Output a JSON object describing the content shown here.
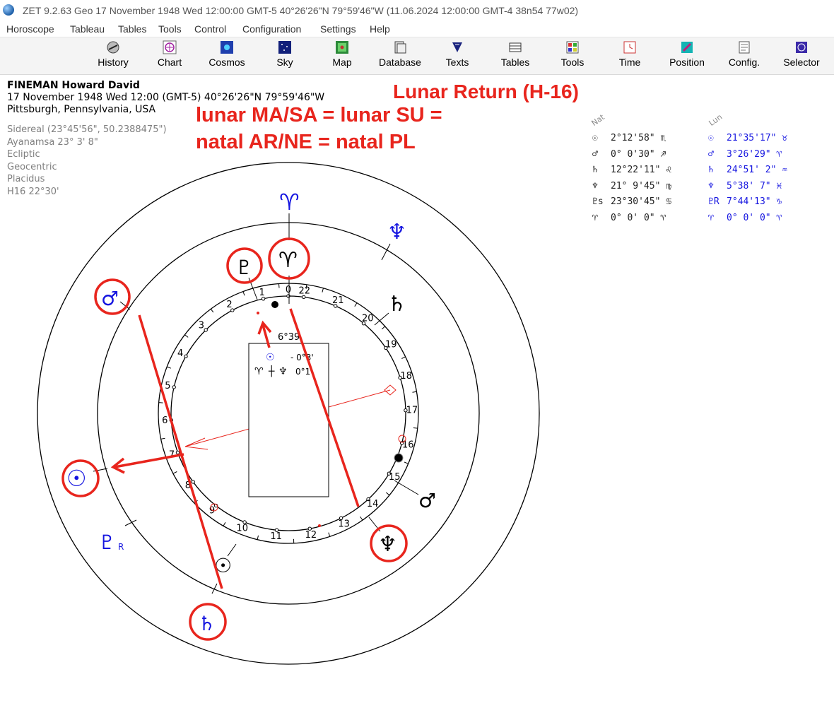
{
  "window": {
    "title": "ZET 9.2.63 Geo   17 November 1948  Wed  12:00:00 GMT-5 40°26'26\"N  79°59'46\"W  (11.06.2024  12:00:00 GMT-4 38n54 77w02)"
  },
  "menu": [
    "Horoscope",
    "Tableau",
    "Tables",
    "Tools",
    "Control",
    "Configuration",
    "Settings",
    "Help"
  ],
  "toolbar": [
    {
      "label": "History",
      "icon": "history-icon"
    },
    {
      "label": "Chart",
      "icon": "chart-icon"
    },
    {
      "label": "Cosmos",
      "icon": "cosmos-icon"
    },
    {
      "label": "Sky",
      "icon": "sky-icon"
    },
    {
      "label": "Map",
      "icon": "map-icon"
    },
    {
      "label": "Database",
      "icon": "database-icon"
    },
    {
      "label": "Texts",
      "icon": "texts-icon"
    },
    {
      "label": "Tables",
      "icon": "tables-icon"
    },
    {
      "label": "Tools",
      "icon": "tools-icon"
    },
    {
      "label": "Time",
      "icon": "time-icon"
    },
    {
      "label": "Position",
      "icon": "position-icon"
    },
    {
      "label": "Config.",
      "icon": "config-icon"
    },
    {
      "label": "Selector",
      "icon": "selector-icon"
    }
  ],
  "person": {
    "name": "FINEMAN Howard David",
    "date_line": "17 November 1948  Wed  12:00 (GMT-5) 40°26'26\"N  79°59'46\"W",
    "place": "Pittsburgh, Pennsylvania, USA"
  },
  "settings": [
    "Sidereal (23°45'56\", 50.2388475\")",
    "Ayanamsa 23° 3' 8\"",
    "Ecliptic",
    "Geocentric",
    "Placidus",
    "H16  22°30'"
  ],
  "annotations": {
    "title": "Lunar Return (H-16)",
    "line1": "lunar MA/SA = lunar SU =",
    "line2": "natal AR/NE = natal PL"
  },
  "positions": {
    "nat_header": "Nat",
    "lun_header": "Lun",
    "rows": [
      {
        "nat_sym": "☉",
        "nat": "2°12'58\" ♏",
        "lun_sym": "☉",
        "lun": "21°35'17\" ♉"
      },
      {
        "nat_sym": "♂",
        "nat": "0° 0'30\" ♐",
        "lun_sym": "♂",
        "lun": "3°26'29\" ♈"
      },
      {
        "nat_sym": "♄",
        "nat": "12°22'11\" ♌",
        "lun_sym": "♄",
        "lun": "24°51' 2\" ♒"
      },
      {
        "nat_sym": "♆",
        "nat": "21° 9'45\" ♍",
        "lun_sym": "♆",
        "lun": "5°38' 7\" ♓"
      },
      {
        "nat_sym": "♇s",
        "nat": "23°30'45\" ♋",
        "lun_sym": "♇R",
        "lun": "7°44'13\" ♑"
      },
      {
        "nat_sym": "♈",
        "nat": "0° 0' 0\" ♈",
        "lun_sym": "♈",
        "lun": "0° 0' 0\" ♈"
      }
    ]
  },
  "chart": {
    "inner_house_numbers": [
      "22",
      "21",
      "20",
      "19",
      "18",
      "17",
      "16",
      "15",
      "14",
      "13",
      "12",
      "11",
      "10",
      "9",
      "8",
      "7",
      "6",
      "5",
      "4",
      "3",
      "2",
      "1",
      "0"
    ],
    "center_box": {
      "top_value": "6°39",
      "line1_value": "- 0°3'",
      "line2_value": "0°1'"
    },
    "outer_glyphs": {
      "aries_top": "♈",
      "neptune_top_right": "♆",
      "mars_left": "♂",
      "sun_left": "☉",
      "pluto_left": "♇",
      "pluto_left_retro": "R",
      "saturn_bottom": "♄"
    },
    "middle_glyphs": {
      "pluto": "♇",
      "aries": "♈",
      "saturn": "♄",
      "mars": "♂",
      "neptune": "♆",
      "sun": "☉"
    },
    "colors": {
      "annotation_red": "#e8251d",
      "lunar_blue": "#1515e0",
      "ring_line": "#000000"
    }
  }
}
